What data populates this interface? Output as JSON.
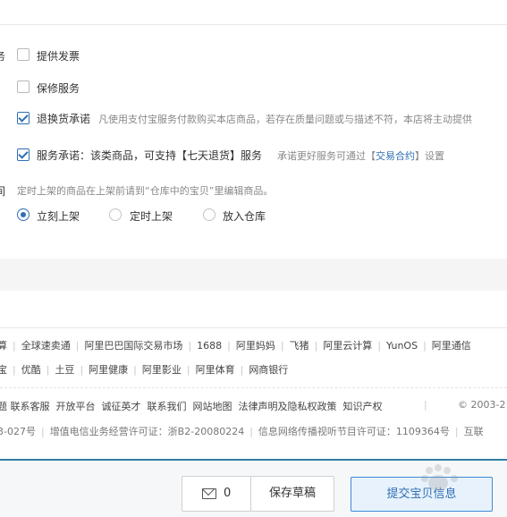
{
  "services": {
    "section_label_fragment": "务",
    "invoice_label": "提供发票",
    "warranty_label": "保修服务",
    "return_label": "退换货承诺",
    "return_note": "凡使用支付宝服务付款购买本店商品，若存在质量问题或与描述不符，本店将主动提供",
    "service_promise_label": "服务承诺：该类商品，可支持【七天退货】服务",
    "promise_note_prefix": "承诺更好服务可通过【",
    "promise_note_link": "交易合约",
    "promise_note_suffix": "】设置"
  },
  "listing": {
    "section_label_fragment": "间",
    "hint": "定时上架的商品在上架前请到“仓库中的宝贝”里编辑商品。",
    "options": [
      "立刻上架",
      "定时上架",
      "放入仓库"
    ],
    "selected": "立刻上架"
  },
  "footer": {
    "row1": [
      "算",
      "全球速卖通",
      "阿里巴巴国际交易市场",
      "1688",
      "阿里妈妈",
      "飞猪",
      "阿里云计算",
      "YunOS",
      "阿里通信"
    ],
    "row2": [
      "宝",
      "优酷",
      "土豆",
      "阿里健康",
      "阿里影业",
      "阿里体育",
      "网商银行"
    ],
    "row3": [
      "题",
      "联系客服",
      "开放平台",
      "诚征英才",
      "联系我们",
      "网站地图",
      "法律声明及隐私权政策",
      "知识产权"
    ],
    "row3_copyright": "© 2003-2",
    "row4": [
      "3-027号",
      "增值电信业务经营许可证：浙B2-20080224",
      "信息网络传播视听节目许可证：1109364号",
      "互联"
    ]
  },
  "actions": {
    "message_count": "0",
    "save_draft": "保存草稿",
    "submit": "提交宝贝信息"
  },
  "watermark_text": "Bai du 经验"
}
